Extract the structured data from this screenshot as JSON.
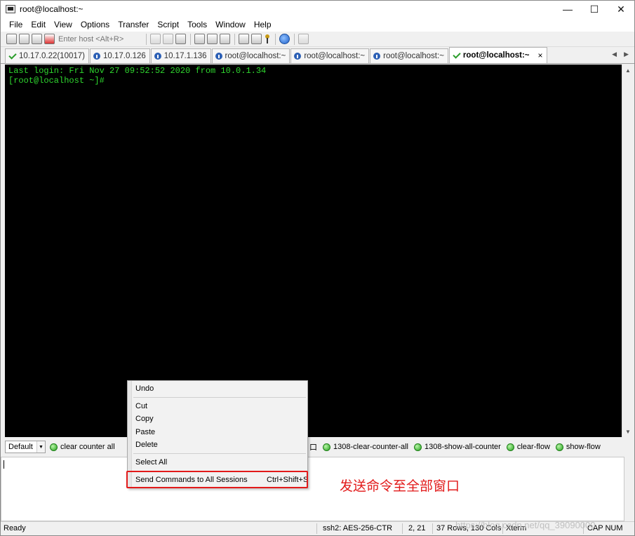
{
  "window": {
    "title": "root@localhost:~",
    "minimize": "—",
    "maximize": "☐",
    "close": "✕"
  },
  "menu": [
    "File",
    "Edit",
    "View",
    "Options",
    "Transfer",
    "Script",
    "Tools",
    "Window",
    "Help"
  ],
  "toolbar": {
    "host_placeholder": "Enter host <Alt+R>"
  },
  "tabs": [
    {
      "label": "10.17.0.22(10017)",
      "icon": "check-icon"
    },
    {
      "label": "10.17.0.126",
      "icon": "info-icon"
    },
    {
      "label": "10.17.1.136",
      "icon": "info-icon"
    },
    {
      "label": "root@localhost:~",
      "icon": "info-icon"
    },
    {
      "label": "root@localhost:~",
      "icon": "info-icon"
    },
    {
      "label": "root@localhost:~",
      "icon": "info-icon"
    },
    {
      "label": "root@localhost:~",
      "icon": "check-icon",
      "active": true
    }
  ],
  "tab_close": "×",
  "tab_arrows": {
    "left": "◀",
    "right": "▶"
  },
  "terminal": {
    "line1": "Last login: Fri Nov 27 09:52:52 2020 from 10.0.1.34",
    "line2": "[root@localhost ~]#",
    "text_color": "#2fd82f"
  },
  "scroll_arrows": {
    "up": "▲",
    "down": "▼"
  },
  "buttonbar": {
    "select_value": "Default",
    "select_arrow": "▼",
    "left_buttons": [
      "clear counter all"
    ],
    "truncated": "口",
    "right_buttons": [
      "1308-clear-counter-all",
      "1308-show-all-counter",
      "clear-flow",
      "show-flow"
    ]
  },
  "context_menu": {
    "undo": "Undo",
    "cut": "Cut",
    "copy": "Copy",
    "paste": "Paste",
    "delete": "Delete",
    "select_all": "Select All",
    "send_all": "Send Commands to All Sessions",
    "send_all_shortcut": "Ctrl+Shift+S"
  },
  "annotation": "发送命令至全部窗口",
  "status": {
    "ready": "Ready",
    "cipher": "ssh2: AES-256-CTR",
    "cursor": "2,  21",
    "size": "37 Rows, 130 Cols",
    "term": "Xterm",
    "keys": "CAP NUM"
  },
  "watermark": "https://blog.csdn.net/qq_39090000",
  "colors": {
    "accent_red": "#e21a1a",
    "terminal_bg": "#000000"
  }
}
